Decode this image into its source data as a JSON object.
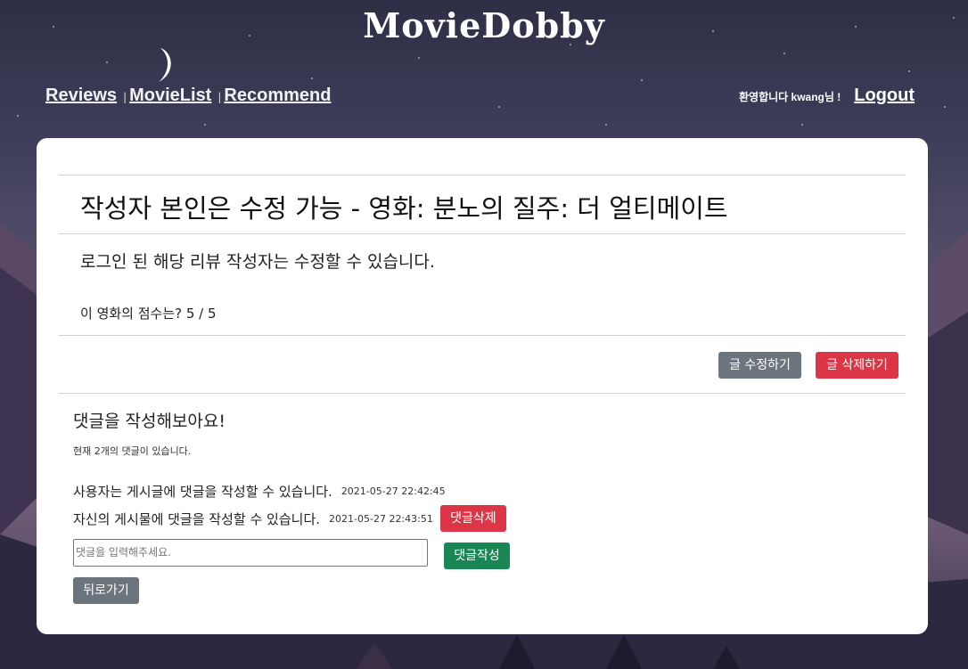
{
  "header": {
    "brand": "MovieDobby",
    "nav": [
      {
        "label": "Reviews"
      },
      {
        "label": "MovieList"
      },
      {
        "label": "Recommend"
      }
    ],
    "nav_separator": "|",
    "welcome": "환영합니다 kwang님 !",
    "logout_label": "Logout"
  },
  "review": {
    "title": "작성자 본인은 수정 가능 - 영화: 분노의 질주: 더 얼티메이트",
    "content": "로그인 된 해당 리뷰 작성자는 수정할 수 있습니다.",
    "score_text": "이 영화의 점수는? 5 / 5",
    "edit_label": "글 수정하기",
    "delete_label": "글 삭제하기"
  },
  "comments": {
    "heading": "댓글을 작성해보아요!",
    "count_text": "현재 2개의 댓글이 있습니다.",
    "items": [
      {
        "text": "사용자는 게시글에 댓글을 작성할 수 있습니다.",
        "time": "2021-05-27 22:42:45"
      },
      {
        "text": "자신의 게시물에 댓글을 작성할 수 있습니다.",
        "time": "2021-05-27 22:43:51",
        "delete_label": "댓글삭제"
      }
    ],
    "input_placeholder": "댓글을 입력해주세요.",
    "submit_label": "댓글작성",
    "back_label": "뒤로가기"
  },
  "colors": {
    "gray_button": "#6c757d",
    "red_button": "#dc3545",
    "green_button": "#198754"
  }
}
